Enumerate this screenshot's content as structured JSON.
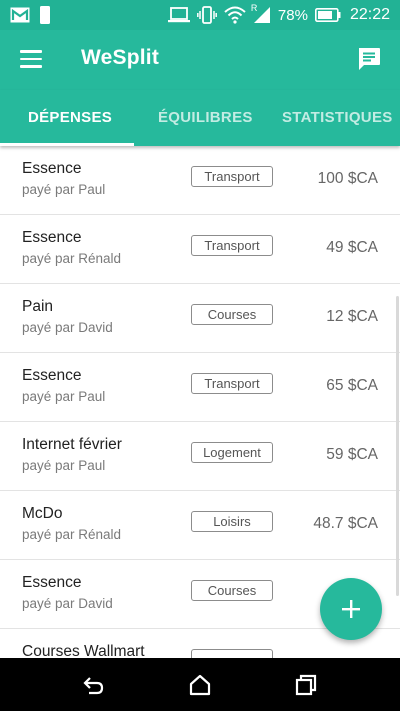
{
  "status_bar": {
    "battery_percent": "78%",
    "time": "22:22",
    "network_badge": "R",
    "icons": [
      "gmail-icon",
      "phone-icon",
      "laptop-icon",
      "vibrate-icon",
      "wifi-icon",
      "signal-icon",
      "battery-icon"
    ]
  },
  "app_bar": {
    "title": "WeSplit",
    "background": "#26b99c",
    "menu_icon": "hamburger-menu-icon",
    "action_icon": "chat-icon"
  },
  "tabs": [
    {
      "label": "DÉPENSES",
      "active": true
    },
    {
      "label": "ÉQUILIBRES",
      "active": false
    },
    {
      "label": "STATISTIQUES",
      "active": false
    }
  ],
  "expenses": [
    {
      "title": "Essence",
      "payer": "payé par Paul",
      "category": "Transport",
      "amount": "100 $CA"
    },
    {
      "title": "Essence",
      "payer": "payé par Rénald",
      "category": "Transport",
      "amount": "49 $CA"
    },
    {
      "title": "Pain",
      "payer": "payé par David",
      "category": "Courses",
      "amount": "12 $CA"
    },
    {
      "title": "Essence",
      "payer": "payé par Paul",
      "category": "Transport",
      "amount": "65 $CA"
    },
    {
      "title": "Internet février",
      "payer": "payé par Paul",
      "category": "Logement",
      "amount": "59 $CA"
    },
    {
      "title": "McDo",
      "payer": "payé par Rénald",
      "category": "Loisirs",
      "amount": "48.7 $CA"
    },
    {
      "title": "Essence",
      "payer": "payé par David",
      "category": "Courses",
      "amount": ""
    },
    {
      "title": "Courses Wallmart",
      "payer": "",
      "category": "",
      "amount": ""
    }
  ],
  "fab": {
    "icon": "plus-icon"
  },
  "nav_bar": {
    "icons": [
      "back-icon",
      "home-icon",
      "recents-icon"
    ]
  }
}
